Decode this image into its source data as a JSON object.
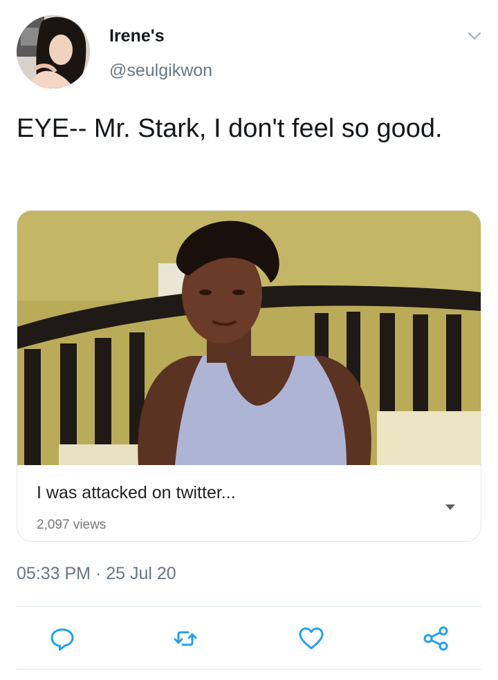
{
  "tweet": {
    "author": {
      "display_name": "Irene's",
      "handle": "@seulgikwon",
      "avatar_icon": "profile-photo"
    },
    "text": "EYE-- Mr. Stark, I don't feel so good.",
    "media": {
      "video_title": "I was attacked on twitter...",
      "views": "2,097 views",
      "thumbnail": "webcam-still-woman-in-tank-top-on-bed"
    },
    "timestamp": "05:33 PM · 25 Jul 20",
    "actions": [
      "reply-icon",
      "retweet-icon",
      "like-icon",
      "share-icon"
    ]
  },
  "colors": {
    "text": "#14171a",
    "secondary": "#657786",
    "icon": "#1da1f2",
    "border": "#e1e8ed"
  }
}
